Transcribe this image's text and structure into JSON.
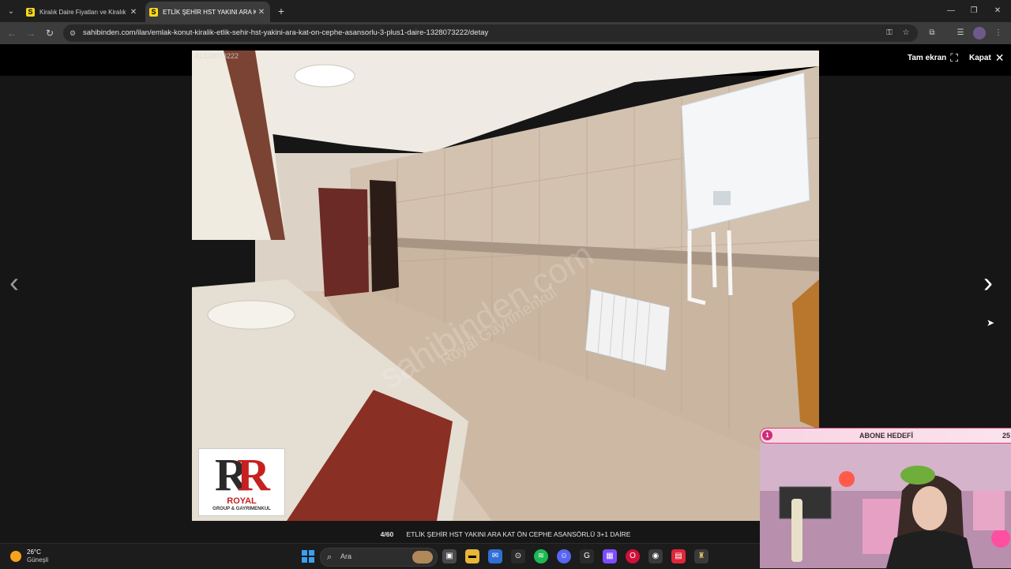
{
  "browser": {
    "tabs": [
      {
        "title": "Kiralık Daire Fiyatları ve Kiralık Ev İlanları",
        "favicon": "S",
        "active": false
      },
      {
        "title": "ETLİK ŞEHİR HST YAKINI ARA KAT",
        "favicon": "S",
        "active": true
      }
    ],
    "url": "sahibinden.com/ilan/emlak-konut-kiralik-etlik-sehir-hst-yakini-ara-kat-on-cephe-asansorlu-3-plus1-daire-1328073222/detay"
  },
  "viewer": {
    "photo_id": "#1328073222",
    "fullscreen_label": "Tam ekran",
    "close_label": "Kapat",
    "counter": "4/60",
    "caption": "ETLİK ŞEHİR HST YAKINI ARA KAT ÖN CEPHE ASANSÖRLÜ 3+1 DAİRE",
    "watermark_text": "sahibinden.com",
    "watermark_sub": "Royal Gayrimenkul",
    "logo_line1": "ROYAL",
    "logo_line2": "GROUP & GAYRIMENKUL"
  },
  "stream_overlay": {
    "badge_count": "1",
    "title": "ABONE HEDEFİ",
    "goal": "25"
  },
  "taskbar": {
    "weather_temp": "26°C",
    "weather_desc": "Güneşli",
    "search_placeholder": "Ara"
  },
  "colors": {
    "accent": "#d12a78",
    "favicon": "#f9d71c",
    "windows_blue": "#3aa0f3"
  }
}
